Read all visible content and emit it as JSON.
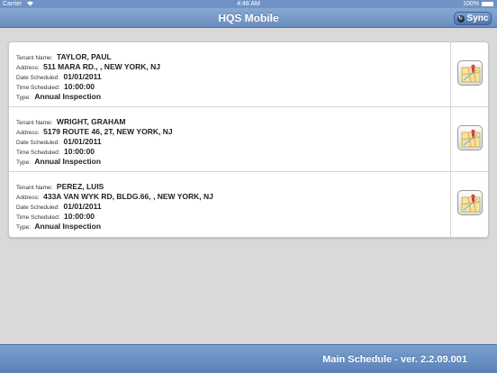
{
  "status_bar": {
    "carrier": "Carrier",
    "time": "4:48 AM",
    "battery": "100%"
  },
  "nav": {
    "title": "HQS Mobile",
    "sync_label": "Sync"
  },
  "labels": {
    "tenant": "Tenant Name:",
    "address": "Address:",
    "date": "Date Scheduled:",
    "time": "Time Scheduled:",
    "type": "Type:"
  },
  "inspections": [
    {
      "tenant": "TAYLOR, PAUL",
      "address": "511 MARA RD., , NEW YORK, NJ",
      "date": "01/01/2011",
      "time": "10:00:00",
      "type": "Annual Inspection"
    },
    {
      "tenant": "WRIGHT, GRAHAM",
      "address": "5179 ROUTE 46, 2T, NEW YORK, NJ",
      "date": "01/01/2011",
      "time": "10:00:00",
      "type": "Annual Inspection"
    },
    {
      "tenant": "PEREZ, LUIS",
      "address": "433A VAN WYK RD, BLDG.66, , NEW YORK, NJ",
      "date": "01/01/2011",
      "time": "10:00:00",
      "type": "Annual Inspection"
    }
  ],
  "footer": {
    "text": "Main Schedule - ver. 2.2.09.001"
  },
  "icons": {
    "map": "map-pin-icon",
    "refresh": "refresh-icon",
    "wifi": "wifi-icon",
    "battery": "battery-icon"
  }
}
